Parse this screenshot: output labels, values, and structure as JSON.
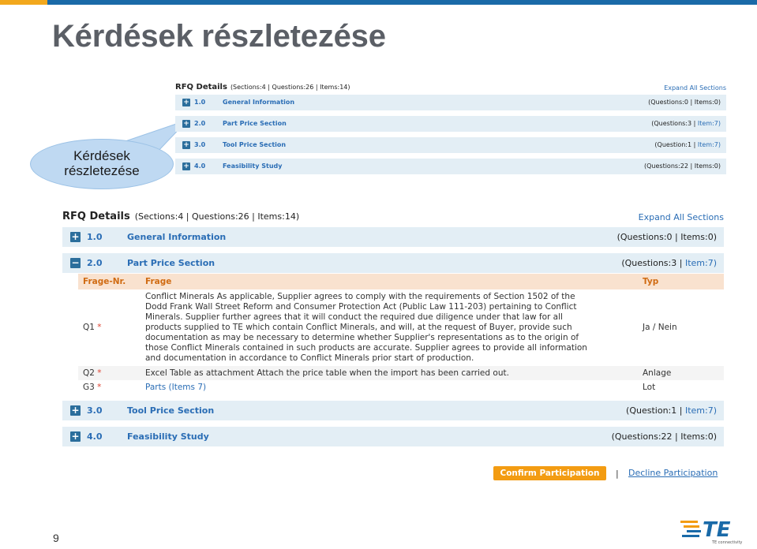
{
  "slide": {
    "title": "Kérdések részletezése",
    "callout": [
      "Kérdések",
      "részletezése"
    ],
    "page_number": "9"
  },
  "small_view": {
    "title": "RFQ Details",
    "counts": "(Sections:4 | Questions:26 | Items:14)",
    "expand": "Expand All Sections",
    "sections": [
      {
        "num": "1.0",
        "name": "General Information",
        "cnt_a": "(Questions:0 | Items:0)",
        "cnt_b": ""
      },
      {
        "num": "2.0",
        "name": "Part Price Section",
        "cnt_a": "(Questions:3 | ",
        "cnt_b": "Item:7)"
      },
      {
        "num": "3.0",
        "name": "Tool Price Section",
        "cnt_a": "(Question:1 | ",
        "cnt_b": "Item:7)"
      },
      {
        "num": "4.0",
        "name": "Feasibility Study",
        "cnt_a": "(Questions:22 | Items:0)",
        "cnt_b": ""
      }
    ]
  },
  "big_view": {
    "title": "RFQ Details",
    "counts": "(Sections:4 | Questions:26 | Items:14)",
    "expand": "Expand All Sections",
    "sections": [
      {
        "num": "1.0",
        "name": "General Information",
        "cnt_a": "(Questions:0 | Items:0)",
        "cnt_b": ""
      },
      {
        "num": "2.0",
        "name": "Part Price Section",
        "cnt_a": "(Questions:3 | ",
        "cnt_b": "Item:7)"
      },
      {
        "num": "3.0",
        "name": "Tool Price Section",
        "cnt_a": "(Question:1 | ",
        "cnt_b": "Item:7)"
      },
      {
        "num": "4.0",
        "name": "Feasibility Study",
        "cnt_a": "(Questions:22 | Items:0)",
        "cnt_b": ""
      }
    ],
    "table": {
      "headers": [
        "Frage-Nr.",
        "Frage",
        "Typ"
      ],
      "rows": [
        {
          "nr": "Q1",
          "lines": [
            "Conflict Minerals As applicable, Supplier agrees to comply with the requirements of Section 1502 of the",
            "Dodd Frank Wall Street Reform and Consumer Protection Act (Public Law 111-203) pertaining to Conflict",
            "Minerals. Supplier further agrees that it will conduct the required due diligence under that law for all",
            "products supplied to TE which contain Conflict Minerals, and will, at the request of Buyer, provide such",
            "documentation as may be necessary to determine whether Supplier's representations as to the origin of",
            "those Conflict Minerals contained in such products are accurate. Supplier agrees to provide all information",
            "and documentation in accordance to Conflict Minerals prior start of production."
          ],
          "typ": "Ja / Nein"
        },
        {
          "nr": "Q2",
          "frage": "Excel Table as attachment Attach the price table when the import has been carried out.",
          "typ": "Anlage"
        },
        {
          "nr": "G3",
          "frage": "Parts (Items 7)",
          "typ": "Lot"
        }
      ]
    },
    "confirm": "Confirm Participation",
    "separator": "|",
    "decline": "Decline Participation"
  },
  "colors": {
    "accent": "#f39c12",
    "link": "#2a6db5",
    "section_bg": "#e3eef5",
    "header_orange": "#d06b12"
  },
  "logo_text": "TE connectivity"
}
